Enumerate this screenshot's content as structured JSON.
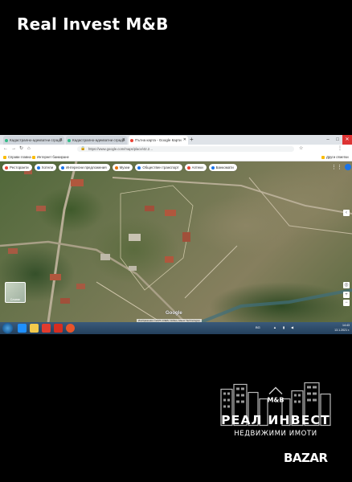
{
  "page_title": "Real Invest M&B",
  "browser": {
    "tabs": [
      {
        "label": "Кадастрално-адекватни сгради"
      },
      {
        "label": "Кадастрално-адекватни сгради"
      },
      {
        "label": "Пътна карта - Google Карти",
        "active": true
      }
    ],
    "new_tab": "+",
    "url": "https://www.google.com/maps/place/42.2…",
    "bookmarks": [
      "Справи главна",
      "Интернет банкиране"
    ],
    "bookmarks_right": "Други отметки"
  },
  "map": {
    "chips": [
      {
        "label": "Ресторанти",
        "color": "#ea4335"
      },
      {
        "label": "Хотели",
        "color": "#1a73e8"
      },
      {
        "label": "Интересни предложения",
        "color": "#1a73e8"
      },
      {
        "label": "Музеи",
        "color": "#e8710a"
      },
      {
        "label": "Обществен транспорт",
        "color": "#1a73e8"
      },
      {
        "label": "Аптеки",
        "color": "#ea4335"
      },
      {
        "label": "Банкомати",
        "color": "#1a73e8"
      }
    ],
    "layers_label": "Слоеве",
    "google_label": "Google",
    "attribution": "Изображения ©2021 CNES / Airbus, Maxar Technologies"
  },
  "taskbar": {
    "language": "BG",
    "time": "14:43",
    "date": "13.1.2021 г."
  },
  "logo": {
    "mark": "M&B",
    "line1": "РЕАЛ ИНВЕСТ",
    "line2": "НЕДВИЖИМИ ИМОТИ"
  },
  "watermark": "BAZAR",
  "colors": {
    "accent": "#1a73e8",
    "background": "#000000"
  }
}
